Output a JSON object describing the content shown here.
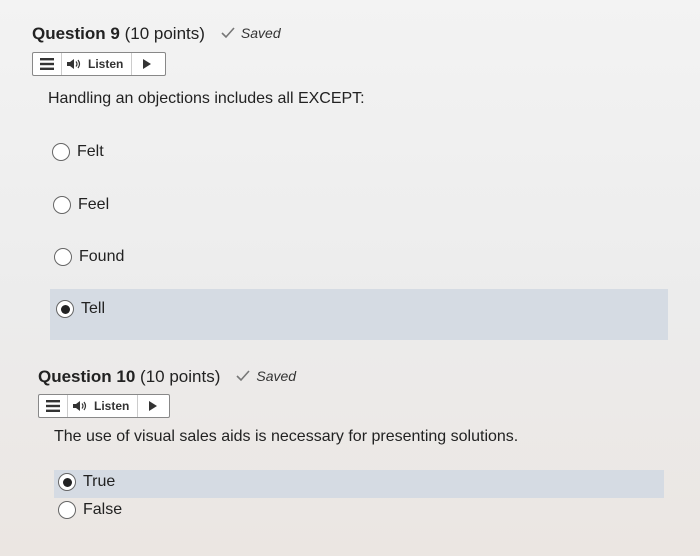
{
  "q9": {
    "title_bold": "Question 9",
    "points": "(10 points)",
    "saved": "Saved",
    "listen": "Listen",
    "prompt": "Handling an objections includes all EXCEPT:",
    "options": [
      "Felt",
      "Feel",
      "Found",
      "Tell"
    ],
    "selected": "Tell"
  },
  "q10": {
    "title_bold": "Question 10",
    "points": "(10 points)",
    "saved": "Saved",
    "listen": "Listen",
    "prompt": "The use of visual sales aids is necessary for presenting solutions.",
    "options": [
      "True",
      "False"
    ],
    "selected": "True"
  },
  "colors": {
    "selected_bg": "#d5dbe3",
    "text": "#222222"
  },
  "icons": [
    "checkmark-icon",
    "menu-icon",
    "speaker-icon",
    "play-icon",
    "radio-icon"
  ]
}
